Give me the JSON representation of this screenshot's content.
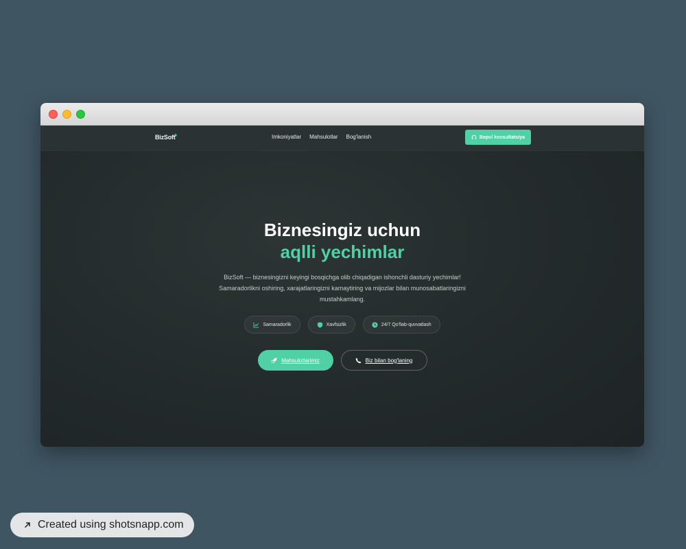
{
  "navbar": {
    "logo": "BizSoft",
    "links": [
      "Imkoniyatlar",
      "Mahsulotlar",
      "Bog'lanish"
    ],
    "cta_label": "Bepul konsultatsiya"
  },
  "hero": {
    "title": "Biznesingiz uchun",
    "title_accent": "aqlli yechimlar",
    "description": "BizSoft — biznesingizni keyingi bosqichga olib chiqadigan ishonchli dasturiy yechimlar! Samaradorlikni oshiring, xarajatlaringizni kamaytiring va mijozlar bilan munosabatlaringizni mustahkamlang.",
    "badges": [
      {
        "label": "Samaradorlik",
        "icon": "chart-line-icon"
      },
      {
        "label": "Xavfsizlik",
        "icon": "shield-icon"
      },
      {
        "label": "24/7 Qo'llab-quvvatlash",
        "icon": "clock-icon"
      }
    ],
    "primary_button": "Mahsulotlarimiz",
    "secondary_button": "Biz bilan bog'laning"
  },
  "credit": {
    "label": "Created using shotsnapp.com",
    "icon": "arrow-up-right-icon"
  },
  "colors": {
    "accent": "#4fd1a5",
    "background": "#3f5562",
    "page_dark": "#22292b"
  }
}
